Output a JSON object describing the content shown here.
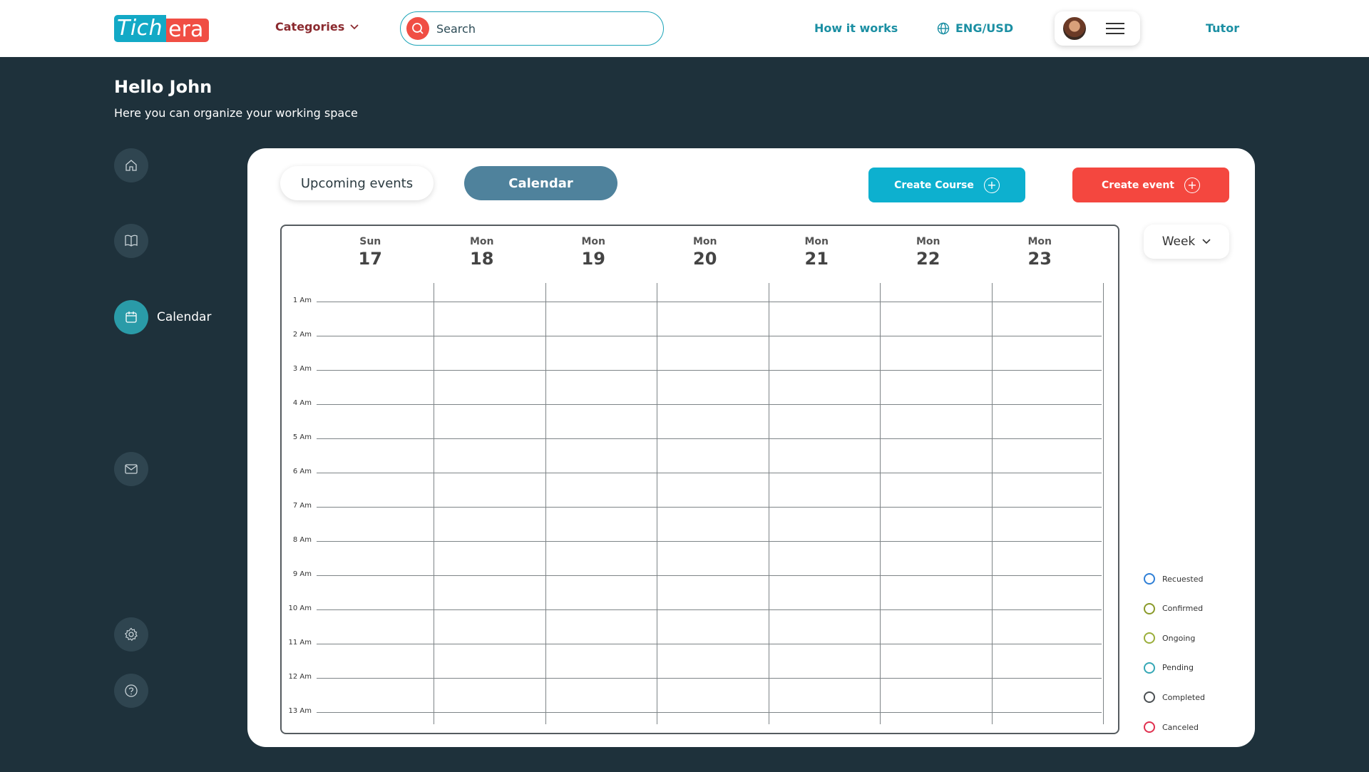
{
  "header": {
    "logo_part1": "Tich",
    "logo_part2": "era",
    "categories_label": "Categories",
    "search_placeholder": "Search",
    "how_it_works": "How it works",
    "language": "ENG/USD",
    "tutor": "Tutor"
  },
  "greeting": {
    "title": "Hello John",
    "subtitle": "Here you can organize your working space"
  },
  "sidebar": {
    "items": [
      {
        "icon": "home-icon",
        "label": ""
      },
      {
        "icon": "book-icon",
        "label": ""
      },
      {
        "icon": "calendar-icon",
        "label": "Calendar",
        "active": true
      },
      {
        "icon": "mail-icon",
        "label": ""
      },
      {
        "icon": "gear-icon",
        "label": ""
      },
      {
        "icon": "help-icon",
        "label": ""
      }
    ]
  },
  "tabs": {
    "upcoming": "Upcoming events",
    "calendar": "Calendar"
  },
  "actions": {
    "create_course": "Create Course",
    "create_event": "Create event"
  },
  "calendar": {
    "days": [
      {
        "name": "Sun",
        "date": "17"
      },
      {
        "name": "Mon",
        "date": "18"
      },
      {
        "name": "Mon",
        "date": "19"
      },
      {
        "name": "Mon",
        "date": "20"
      },
      {
        "name": "Mon",
        "date": "21"
      },
      {
        "name": "Mon",
        "date": "22"
      },
      {
        "name": "Mon",
        "date": "23"
      }
    ],
    "times": [
      "1 Am",
      "2 Am",
      "3 Am",
      "4 Am",
      "5 Am",
      "6 Am",
      "7 Am",
      "8 Am",
      "9 Am",
      "10 Am",
      "11 Am",
      "12 Am",
      "13 Am"
    ],
    "view": "Week"
  },
  "legend": [
    {
      "label": "Recuested",
      "color": "#2f7fd6"
    },
    {
      "label": "Confirmed",
      "color": "#8a9a2a"
    },
    {
      "label": "Ongoing",
      "color": "#9aae3a"
    },
    {
      "label": "Pending",
      "color": "#35a7b5"
    },
    {
      "label": "Completed",
      "color": "#4a4f52"
    },
    {
      "label": "Canceled",
      "color": "#e0304f"
    }
  ],
  "colors": {
    "background": "#1e313b",
    "accent_teal": "#0db0cf",
    "accent_red": "#f4473f",
    "tab_active": "#4f829c"
  }
}
